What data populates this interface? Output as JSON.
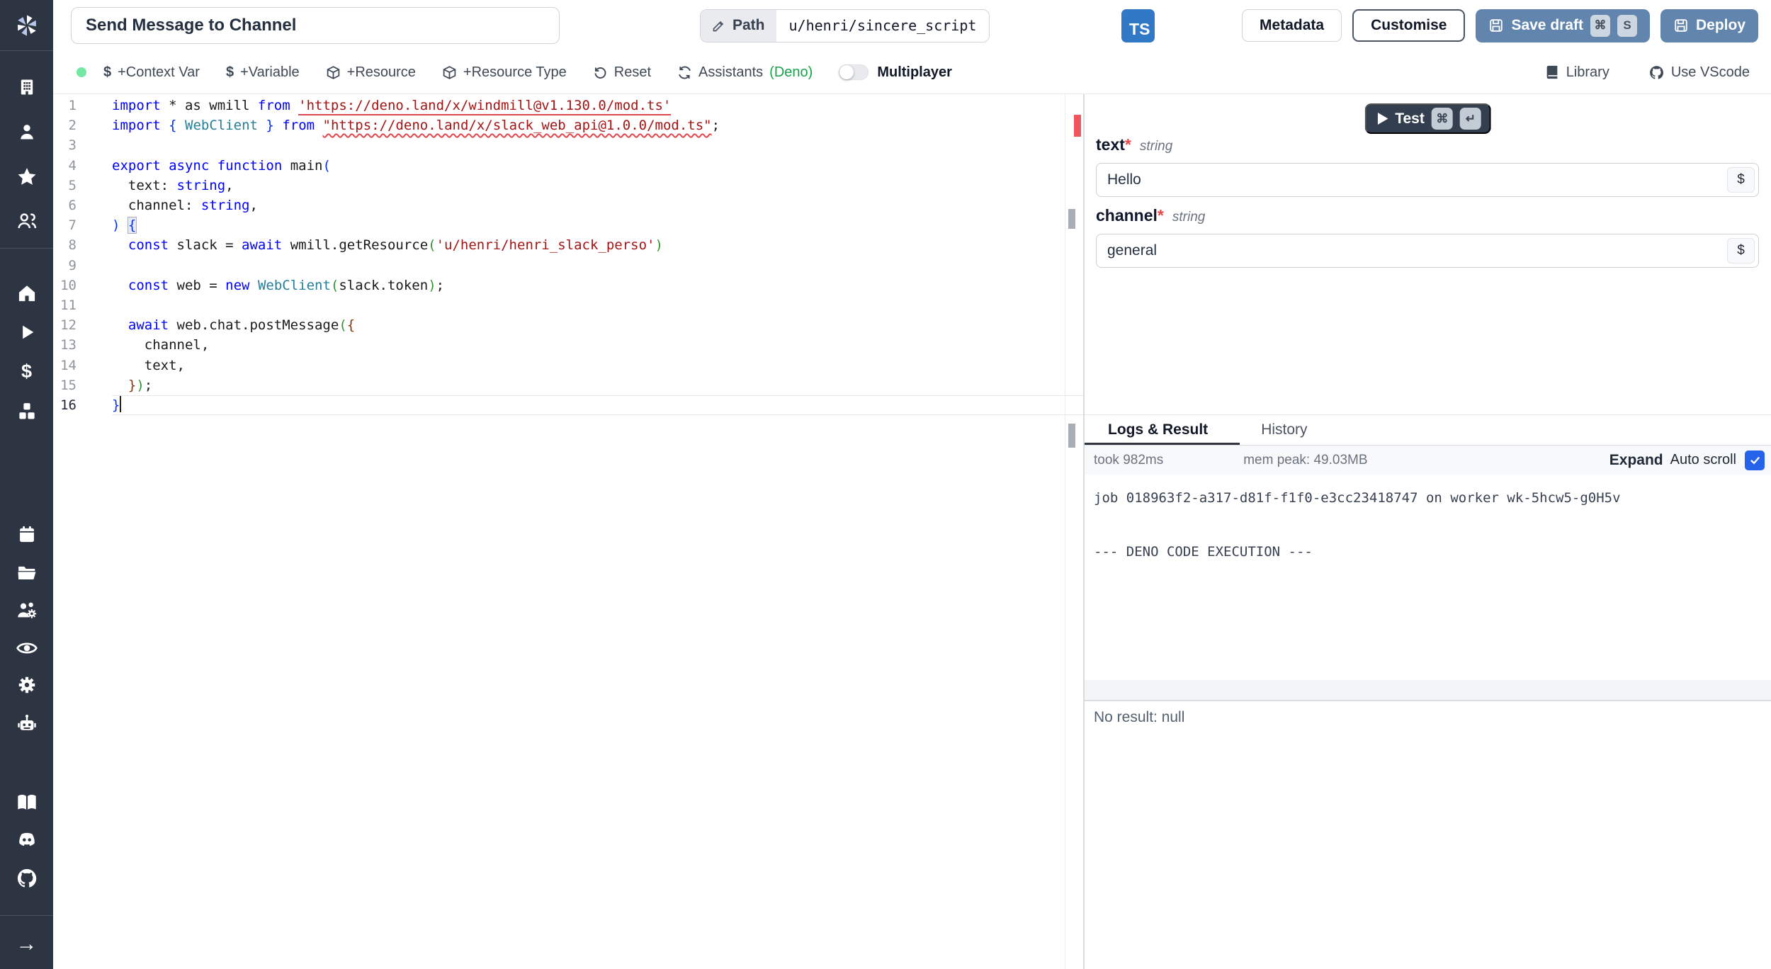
{
  "header": {
    "title": "Send Message to Channel",
    "path_label": "Path",
    "path_value": "u/henri/sincere_script",
    "lang_badge": "TS",
    "metadata_label": "Metadata",
    "customise_label": "Customise",
    "save_draft_label": "Save draft",
    "save_kbd": [
      "⌘",
      "S"
    ],
    "deploy_label": "Deploy"
  },
  "toolbar": {
    "context_var": "+Context Var",
    "variable": "+Variable",
    "resource": "+Resource",
    "resource_type": "+Resource Type",
    "reset": "Reset",
    "assistants": "Assistants",
    "assistants_lang": "(Deno)",
    "multiplayer": "Multiplayer",
    "library": "Library",
    "vscode": "Use VScode"
  },
  "icons": {
    "dollar": "$",
    "command": "⌘",
    "return": "↵",
    "arrow_right": "→"
  },
  "editor": {
    "language": "typescript",
    "lines": [
      {
        "n": "1",
        "segs": [
          [
            "kw",
            "import"
          ],
          [
            "pl",
            " * as wmill "
          ],
          [
            "kw",
            "from"
          ],
          [
            "pl",
            " "
          ],
          [
            "str us",
            "'https://deno.land/x/windmill@v1.130.0/mod.ts'"
          ]
        ]
      },
      {
        "n": "2",
        "segs": [
          [
            "kw",
            "import"
          ],
          [
            "pl",
            " "
          ],
          [
            "b1",
            "{"
          ],
          [
            "pl",
            " "
          ],
          [
            "ty",
            "WebClient"
          ],
          [
            "pl",
            " "
          ],
          [
            "b1",
            "}"
          ],
          [
            "pl",
            " "
          ],
          [
            "kw",
            "from"
          ],
          [
            "pl",
            " "
          ],
          [
            "str uw",
            "\"https://deno.land/x/slack_web_api@1.0.0/mod.ts\""
          ],
          [
            "pl",
            ";"
          ]
        ]
      },
      {
        "n": "3",
        "segs": []
      },
      {
        "n": "4",
        "segs": [
          [
            "kw",
            "export"
          ],
          [
            "pl",
            " "
          ],
          [
            "kw",
            "async"
          ],
          [
            "pl",
            " "
          ],
          [
            "kw",
            "function"
          ],
          [
            "pl",
            " main"
          ],
          [
            "b1",
            "("
          ]
        ]
      },
      {
        "n": "5",
        "segs": [
          [
            "pl",
            "  text: "
          ],
          [
            "kw",
            "string"
          ],
          [
            "pl",
            ","
          ]
        ]
      },
      {
        "n": "6",
        "segs": [
          [
            "pl",
            "  channel: "
          ],
          [
            "kw",
            "string"
          ],
          [
            "pl",
            ","
          ]
        ]
      },
      {
        "n": "7",
        "segs": [
          [
            "b1",
            ")"
          ],
          [
            "pl",
            " "
          ],
          [
            "b1 bm",
            "{"
          ]
        ]
      },
      {
        "n": "8",
        "segs": [
          [
            "pl",
            "  "
          ],
          [
            "kw",
            "const"
          ],
          [
            "pl",
            " slack = "
          ],
          [
            "kw",
            "await"
          ],
          [
            "pl",
            " wmill.getResource"
          ],
          [
            "b2",
            "("
          ],
          [
            "str",
            "'u/henri/henri_slack_perso'"
          ],
          [
            "b2",
            ")"
          ]
        ]
      },
      {
        "n": "9",
        "segs": []
      },
      {
        "n": "10",
        "segs": [
          [
            "pl",
            "  "
          ],
          [
            "kw",
            "const"
          ],
          [
            "pl",
            " web = "
          ],
          [
            "kw",
            "new"
          ],
          [
            "pl",
            " "
          ],
          [
            "ty",
            "WebClient"
          ],
          [
            "b2",
            "("
          ],
          [
            "pl",
            "slack.token"
          ],
          [
            "b2",
            ")"
          ],
          [
            "pl",
            ";"
          ]
        ]
      },
      {
        "n": "11",
        "segs": []
      },
      {
        "n": "12",
        "segs": [
          [
            "pl",
            "  "
          ],
          [
            "kw",
            "await"
          ],
          [
            "pl",
            " web.chat.postMessage"
          ],
          [
            "b2",
            "("
          ],
          [
            "b3",
            "{"
          ]
        ]
      },
      {
        "n": "13",
        "segs": [
          [
            "pl",
            "    channel,"
          ]
        ]
      },
      {
        "n": "14",
        "segs": [
          [
            "pl",
            "    text,"
          ]
        ]
      },
      {
        "n": "15",
        "segs": [
          [
            "pl",
            "  "
          ],
          [
            "b3",
            "}"
          ],
          [
            "b2",
            ")"
          ],
          [
            "pl",
            ";"
          ]
        ]
      },
      {
        "n": "16",
        "cur": true,
        "segs": [
          [
            "b1",
            "}"
          ]
        ]
      }
    ]
  },
  "run_panel": {
    "test_label": "Test",
    "test_kbd": [
      "⌘",
      "↵"
    ],
    "dollar": "$",
    "fields": [
      {
        "name": "text",
        "required": "*",
        "type": "string",
        "value": "Hello"
      },
      {
        "name": "channel",
        "required": "*",
        "type": "string",
        "value": "general"
      }
    ]
  },
  "logs": {
    "tab_logs": "Logs & Result",
    "tab_history": "History",
    "took": "took 982ms",
    "mem": "mem peak: 49.03MB",
    "expand": "Expand",
    "autoscroll": "Auto scroll",
    "job_line": "job 018963f2-a317-d81f-f1f0-e3cc23418747 on worker wk-5hcw5-g0H5v",
    "exec_line": "--- DENO CODE EXECUTION ---",
    "result": "No result: null"
  },
  "colors": {
    "rail_bg": "#2e3542",
    "steel_button": "#6285ae",
    "test_button": "#333e4f",
    "ts_badge": "#3178c6",
    "checkbox_blue": "#2563eb",
    "deno_green": "#16a34a",
    "status_dot_green": "#74e8a3",
    "error_red": "#e0474d"
  }
}
